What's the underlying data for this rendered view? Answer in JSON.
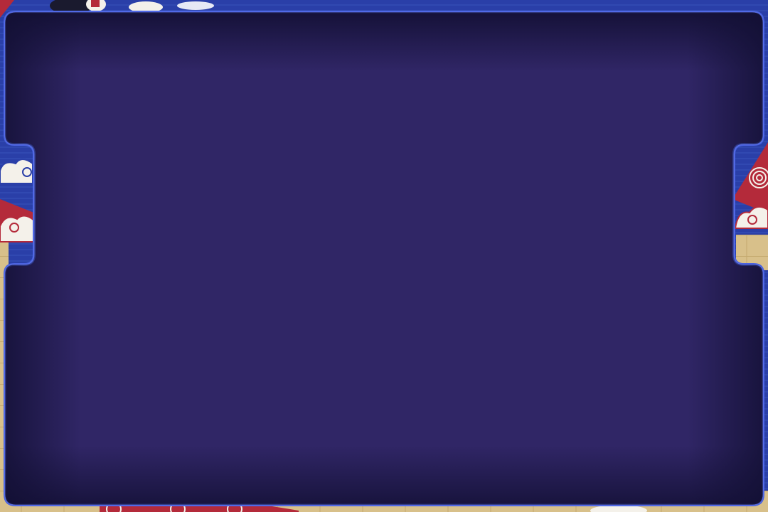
{
  "scene": {
    "description_free": true
  },
  "colors": {
    "wall_blue": "#2a3fa8",
    "wall_stripe": "#3550b8",
    "floor_wood": "#d8c08a",
    "floor_wood_dark": "#c4a96e",
    "pennant_red": "#b42a3a",
    "cloud_white": "#f4f1ea",
    "cloud_stroke": "#2a3fa8",
    "panel_fill": "#302666",
    "panel_shadow": "#120f33",
    "panel_border": "#4a63e0",
    "panel_border_light": "#6f86ff"
  },
  "icons": {
    "cloud": "cloud-icon",
    "spiral": "spiral-ornament-icon"
  }
}
